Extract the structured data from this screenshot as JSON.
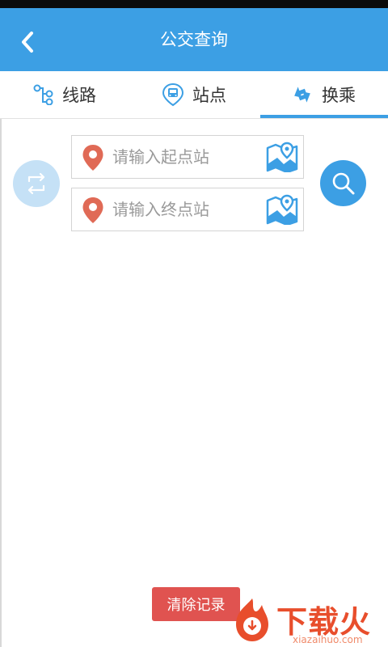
{
  "header": {
    "title": "公交查询"
  },
  "tabs": [
    {
      "label": "线路",
      "icon": "route-icon"
    },
    {
      "label": "站点",
      "icon": "bus-stop-icon"
    },
    {
      "label": "换乘",
      "icon": "transfer-icon",
      "active": true
    }
  ],
  "form": {
    "start_placeholder": "请输入起点站",
    "end_placeholder": "请输入终点站"
  },
  "actions": {
    "clear_label": "清除记录"
  },
  "watermark": {
    "brand": "下载火",
    "url": "xiazaihuo.com"
  },
  "colors": {
    "primary": "#3c9fe4",
    "pin": "#e06a56",
    "clear": "#e05350",
    "swap_bg": "#c5e1f6"
  }
}
